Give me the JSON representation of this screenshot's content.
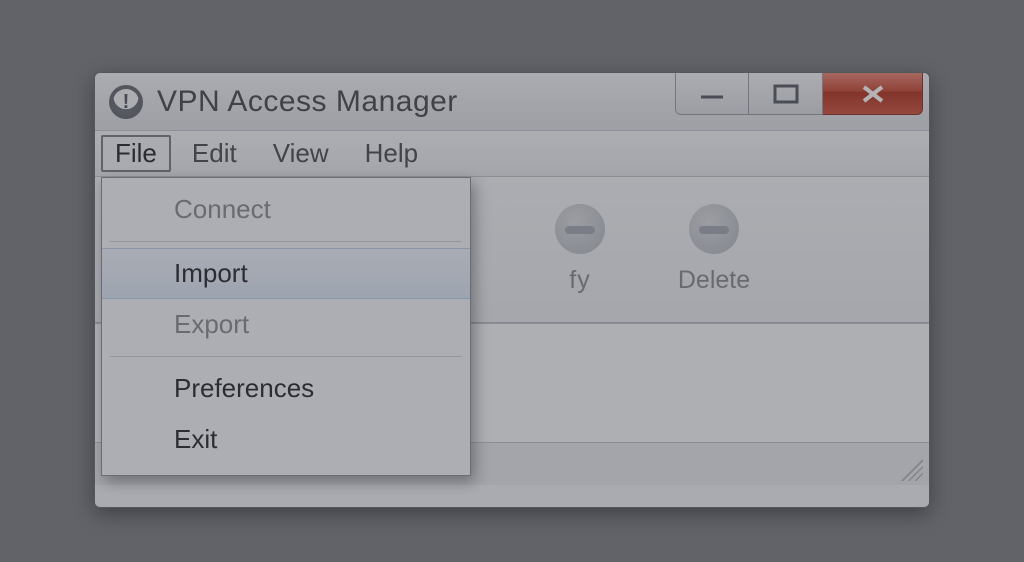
{
  "window": {
    "title": "VPN Access Manager"
  },
  "menubar": {
    "file": "File",
    "edit": "Edit",
    "view": "View",
    "help": "Help"
  },
  "file_menu": {
    "connect": "Connect",
    "import": "Import",
    "export": "Export",
    "preferences": "Preferences",
    "exit": "Exit"
  },
  "toolbar": {
    "modify": "Modify",
    "delete": "Delete"
  }
}
